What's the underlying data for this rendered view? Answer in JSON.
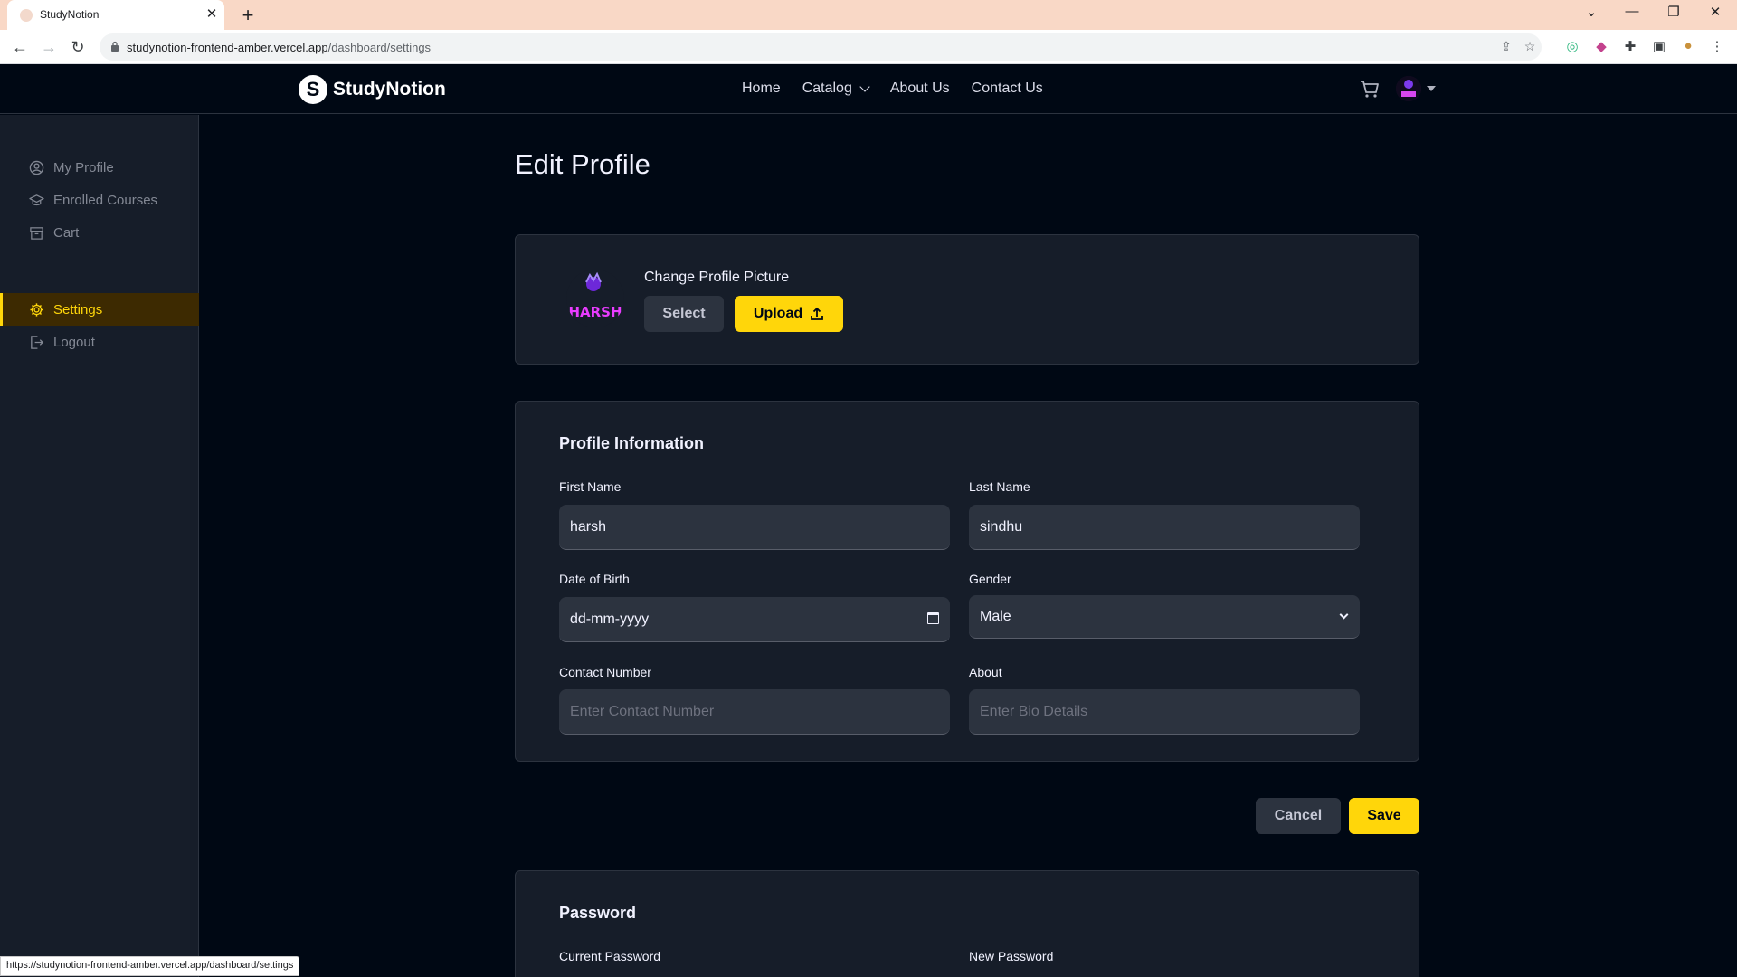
{
  "browser": {
    "tab_title": "StudyNotion",
    "tab_close": "✕",
    "new_tab": "+",
    "url_host": "studynotion-frontend-amber.vercel.app",
    "url_path": "/dashboard/settings",
    "status_url": "https://studynotion-frontend-amber.vercel.app/dashboard/settings"
  },
  "nav": {
    "logo_letter": "S",
    "logo_text": "StudyNotion",
    "links": [
      "Home",
      "Catalog",
      "About Us",
      "Contact Us"
    ]
  },
  "sidebar": {
    "items": [
      {
        "label": "My Profile",
        "icon": "user-circle-icon"
      },
      {
        "label": "Enrolled Courses",
        "icon": "graduation-cap-icon"
      },
      {
        "label": "Cart",
        "icon": "archive-icon"
      }
    ],
    "settings_label": "Settings",
    "logout_label": "Logout",
    "active": "Settings"
  },
  "main": {
    "title": "Edit Profile",
    "picture": {
      "label": "Change Profile Picture",
      "avatar_text": "HARSH",
      "select_label": "Select",
      "upload_label": "Upload"
    },
    "profile_info": {
      "title": "Profile Information",
      "first_name_label": "First Name",
      "first_name_value": "harsh",
      "last_name_label": "Last Name",
      "last_name_value": "sindhu",
      "dob_label": "Date of Birth",
      "dob_value": "dd-mm-yyyy",
      "gender_label": "Gender",
      "gender_value": "Male",
      "contact_label": "Contact Number",
      "contact_placeholder": "Enter Contact Number",
      "about_label": "About",
      "about_placeholder": "Enter Bio Details"
    },
    "actions": {
      "cancel_label": "Cancel",
      "save_label": "Save"
    },
    "password": {
      "title": "Password",
      "current_label": "Current Password",
      "new_label": "New Password"
    }
  },
  "colors": {
    "accent": "#ffd60a",
    "background": "#000814",
    "card": "#161d29",
    "field": "#2c333f"
  }
}
